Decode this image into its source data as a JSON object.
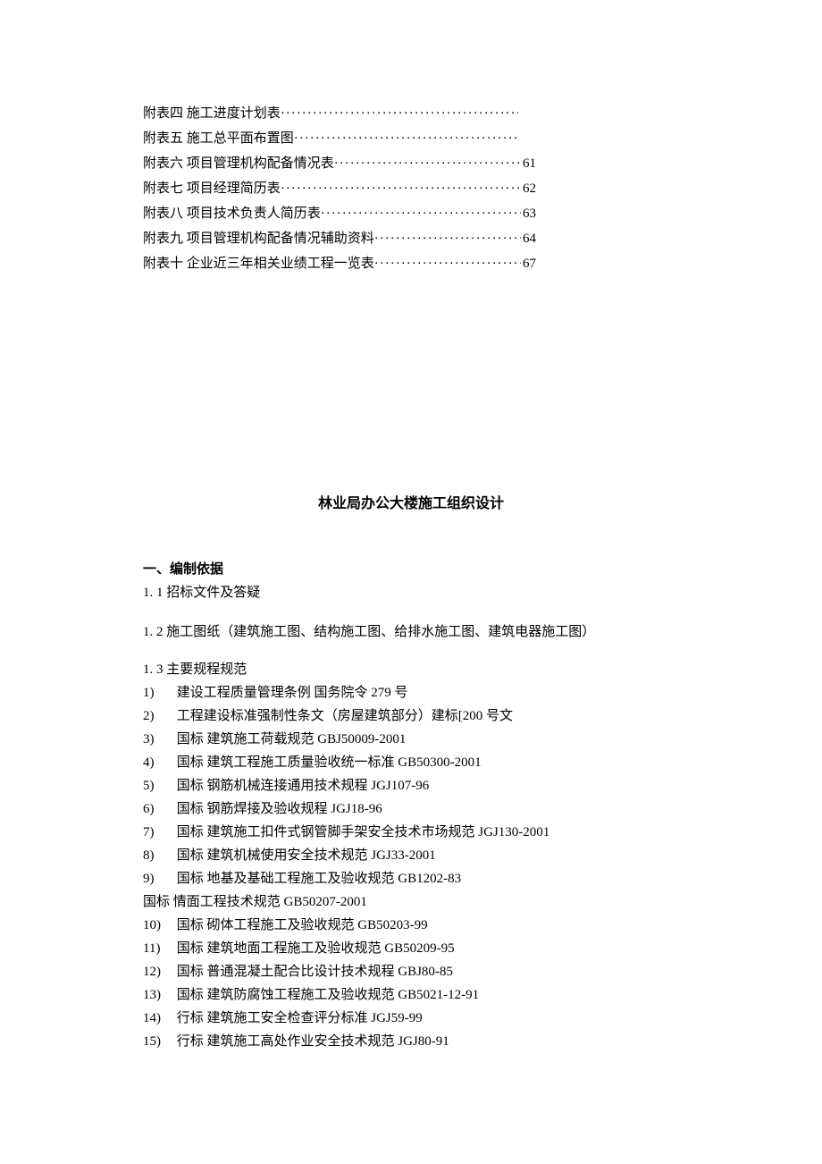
{
  "toc": [
    {
      "label": "附表四  施工进度计划表",
      "page": "",
      "width": "toc-block"
    },
    {
      "label": "附表五  施工总平面布置图",
      "page": "",
      "width": "toc-block"
    },
    {
      "label": "附表六  项目管理机构配备情况表",
      "page": "61",
      "width": "toc-block-wide"
    },
    {
      "label": "附表七  项目经理简历表",
      "page": "62",
      "width": "toc-block-wide"
    },
    {
      "label": "附表八  项目技术负责人简历表",
      "page": "63",
      "width": "toc-block-wide"
    },
    {
      "label": "附表九  项目管理机构配备情况辅助资料",
      "page": "64",
      "width": "toc-block-wide"
    },
    {
      "label": "附表十  企业近三年相关业绩工程一览表",
      "page": "67",
      "width": "toc-block-wide"
    }
  ],
  "title": "林业局办公大楼施工组织设计",
  "section1": {
    "head": "一、编制依据",
    "sub1": "1. 1 招标文件及答疑",
    "sub2": "1. 2 施工图纸（建筑施工图、结构施工图、给排水施工图、建筑电器施工图）",
    "sub3": "1. 3 主要规程规范"
  },
  "standards": [
    {
      "num": "1)",
      "text": "建设工程质量管理条例  国务院令 279 号"
    },
    {
      "num": "2)",
      "text": "工程建设标准强制性条文（房屋建筑部分）建标[200 号文"
    },
    {
      "num": "3)",
      "text": "国标  建筑施工荷载规范 GBJ50009-2001"
    },
    {
      "num": "4)",
      "text": "国标  建筑工程施工质量验收统一标准 GB50300-2001"
    },
    {
      "num": "5)",
      "text": "国标  钢筋机械连接通用技术规程 JGJ107-96"
    },
    {
      "num": "6)",
      "text": "国标  钢筋焊接及验收规程 JGJ18-96"
    },
    {
      "num": "7)",
      "text": "国标  建筑施工扣件式钢管脚手架安全技术市场规范 JGJ130-2001"
    },
    {
      "num": "8)",
      "text": "国标  建筑机械使用安全技术规范 JGJ33-2001"
    },
    {
      "num": "9)",
      "text": "国标  地基及基础工程施工及验收规范 GB1202-83"
    }
  ],
  "standard_noindex": "国标  情面工程技术规范 GB50207-2001",
  "standards2": [
    {
      "num": "10)",
      "text": "国标  砌体工程施工及验收规范 GB50203-99"
    },
    {
      "num": "11)",
      "text": "国标  建筑地面工程施工及验收规范 GB50209-95"
    },
    {
      "num": "12)",
      "text": "国标  普通混凝土配合比设计技术规程 GBJ80-85"
    },
    {
      "num": "13)",
      "text": "国标  建筑防腐蚀工程施工及验收规范 GB5021-12-91"
    },
    {
      "num": "14)",
      "text": "行标  建筑施工安全检查评分标准 JGJ59-99"
    },
    {
      "num": "15)",
      "text": "行标  建筑施工高处作业安全技术规范 JGJ80-91"
    }
  ]
}
